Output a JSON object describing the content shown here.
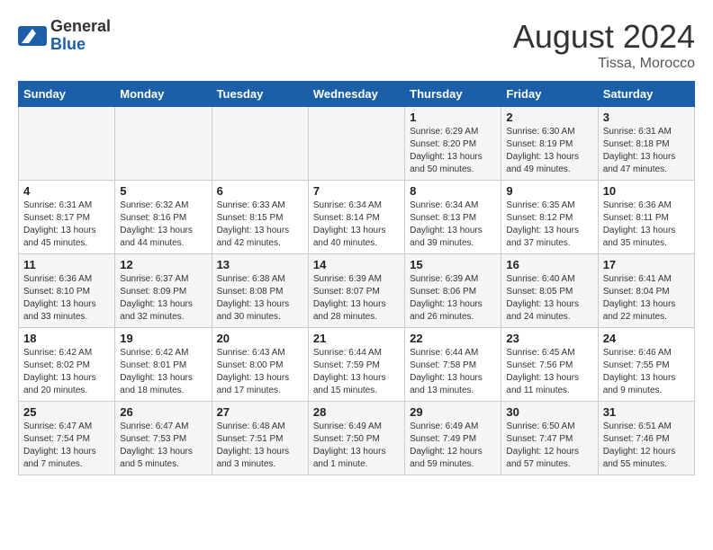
{
  "header": {
    "logo_general": "General",
    "logo_blue": "Blue",
    "month_year": "August 2024",
    "location": "Tissa, Morocco"
  },
  "days_of_week": [
    "Sunday",
    "Monday",
    "Tuesday",
    "Wednesday",
    "Thursday",
    "Friday",
    "Saturday"
  ],
  "weeks": [
    [
      {
        "day": "",
        "content": ""
      },
      {
        "day": "",
        "content": ""
      },
      {
        "day": "",
        "content": ""
      },
      {
        "day": "",
        "content": ""
      },
      {
        "day": "1",
        "content": "Sunrise: 6:29 AM\nSunset: 8:20 PM\nDaylight: 13 hours\nand 50 minutes."
      },
      {
        "day": "2",
        "content": "Sunrise: 6:30 AM\nSunset: 8:19 PM\nDaylight: 13 hours\nand 49 minutes."
      },
      {
        "day": "3",
        "content": "Sunrise: 6:31 AM\nSunset: 8:18 PM\nDaylight: 13 hours\nand 47 minutes."
      }
    ],
    [
      {
        "day": "4",
        "content": "Sunrise: 6:31 AM\nSunset: 8:17 PM\nDaylight: 13 hours\nand 45 minutes."
      },
      {
        "day": "5",
        "content": "Sunrise: 6:32 AM\nSunset: 8:16 PM\nDaylight: 13 hours\nand 44 minutes."
      },
      {
        "day": "6",
        "content": "Sunrise: 6:33 AM\nSunset: 8:15 PM\nDaylight: 13 hours\nand 42 minutes."
      },
      {
        "day": "7",
        "content": "Sunrise: 6:34 AM\nSunset: 8:14 PM\nDaylight: 13 hours\nand 40 minutes."
      },
      {
        "day": "8",
        "content": "Sunrise: 6:34 AM\nSunset: 8:13 PM\nDaylight: 13 hours\nand 39 minutes."
      },
      {
        "day": "9",
        "content": "Sunrise: 6:35 AM\nSunset: 8:12 PM\nDaylight: 13 hours\nand 37 minutes."
      },
      {
        "day": "10",
        "content": "Sunrise: 6:36 AM\nSunset: 8:11 PM\nDaylight: 13 hours\nand 35 minutes."
      }
    ],
    [
      {
        "day": "11",
        "content": "Sunrise: 6:36 AM\nSunset: 8:10 PM\nDaylight: 13 hours\nand 33 minutes."
      },
      {
        "day": "12",
        "content": "Sunrise: 6:37 AM\nSunset: 8:09 PM\nDaylight: 13 hours\nand 32 minutes."
      },
      {
        "day": "13",
        "content": "Sunrise: 6:38 AM\nSunset: 8:08 PM\nDaylight: 13 hours\nand 30 minutes."
      },
      {
        "day": "14",
        "content": "Sunrise: 6:39 AM\nSunset: 8:07 PM\nDaylight: 13 hours\nand 28 minutes."
      },
      {
        "day": "15",
        "content": "Sunrise: 6:39 AM\nSunset: 8:06 PM\nDaylight: 13 hours\nand 26 minutes."
      },
      {
        "day": "16",
        "content": "Sunrise: 6:40 AM\nSunset: 8:05 PM\nDaylight: 13 hours\nand 24 minutes."
      },
      {
        "day": "17",
        "content": "Sunrise: 6:41 AM\nSunset: 8:04 PM\nDaylight: 13 hours\nand 22 minutes."
      }
    ],
    [
      {
        "day": "18",
        "content": "Sunrise: 6:42 AM\nSunset: 8:02 PM\nDaylight: 13 hours\nand 20 minutes."
      },
      {
        "day": "19",
        "content": "Sunrise: 6:42 AM\nSunset: 8:01 PM\nDaylight: 13 hours\nand 18 minutes."
      },
      {
        "day": "20",
        "content": "Sunrise: 6:43 AM\nSunset: 8:00 PM\nDaylight: 13 hours\nand 17 minutes."
      },
      {
        "day": "21",
        "content": "Sunrise: 6:44 AM\nSunset: 7:59 PM\nDaylight: 13 hours\nand 15 minutes."
      },
      {
        "day": "22",
        "content": "Sunrise: 6:44 AM\nSunset: 7:58 PM\nDaylight: 13 hours\nand 13 minutes."
      },
      {
        "day": "23",
        "content": "Sunrise: 6:45 AM\nSunset: 7:56 PM\nDaylight: 13 hours\nand 11 minutes."
      },
      {
        "day": "24",
        "content": "Sunrise: 6:46 AM\nSunset: 7:55 PM\nDaylight: 13 hours\nand 9 minutes."
      }
    ],
    [
      {
        "day": "25",
        "content": "Sunrise: 6:47 AM\nSunset: 7:54 PM\nDaylight: 13 hours\nand 7 minutes."
      },
      {
        "day": "26",
        "content": "Sunrise: 6:47 AM\nSunset: 7:53 PM\nDaylight: 13 hours\nand 5 minutes."
      },
      {
        "day": "27",
        "content": "Sunrise: 6:48 AM\nSunset: 7:51 PM\nDaylight: 13 hours\nand 3 minutes."
      },
      {
        "day": "28",
        "content": "Sunrise: 6:49 AM\nSunset: 7:50 PM\nDaylight: 13 hours\nand 1 minute."
      },
      {
        "day": "29",
        "content": "Sunrise: 6:49 AM\nSunset: 7:49 PM\nDaylight: 12 hours\nand 59 minutes."
      },
      {
        "day": "30",
        "content": "Sunrise: 6:50 AM\nSunset: 7:47 PM\nDaylight: 12 hours\nand 57 minutes."
      },
      {
        "day": "31",
        "content": "Sunrise: 6:51 AM\nSunset: 7:46 PM\nDaylight: 12 hours\nand 55 minutes."
      }
    ]
  ]
}
